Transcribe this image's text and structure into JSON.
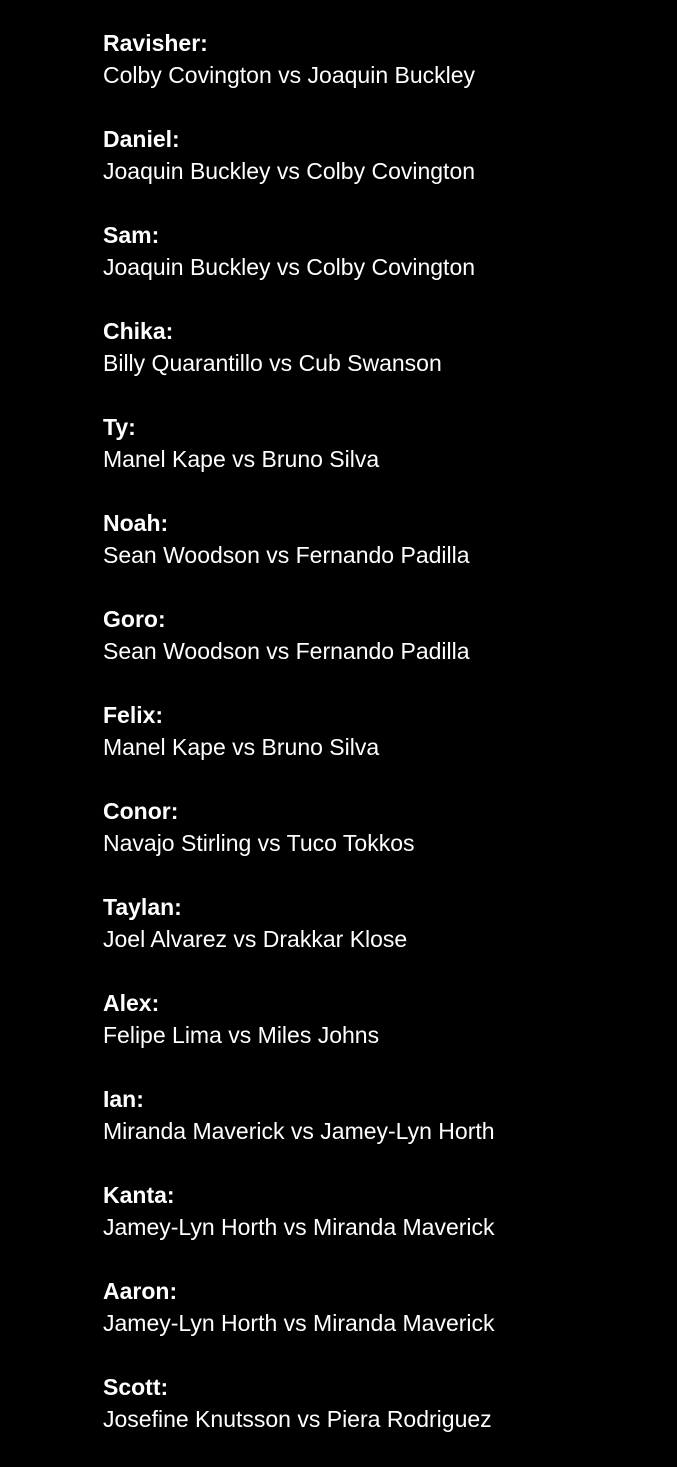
{
  "picks": [
    {
      "name": "Ravisher:",
      "fight": "Colby Covington vs Joaquin Buckley"
    },
    {
      "name": "Daniel:",
      "fight": "Joaquin Buckley vs Colby Covington"
    },
    {
      "name": "Sam:",
      "fight": "Joaquin Buckley vs Colby Covington"
    },
    {
      "name": "Chika:",
      "fight": "Billy Quarantillo vs Cub Swanson"
    },
    {
      "name": "Ty:",
      "fight": "Manel Kape vs Bruno Silva"
    },
    {
      "name": "Noah:",
      "fight": "Sean Woodson vs Fernando Padilla"
    },
    {
      "name": "Goro:",
      "fight": "Sean Woodson vs Fernando Padilla"
    },
    {
      "name": "Felix:",
      "fight": "Manel Kape vs Bruno Silva"
    },
    {
      "name": "Conor:",
      "fight": "Navajo Stirling vs Tuco Tokkos"
    },
    {
      "name": "Taylan:",
      "fight": "Joel Alvarez vs Drakkar Klose"
    },
    {
      "name": "Alex:",
      "fight": "Felipe Lima vs Miles Johns"
    },
    {
      "name": "Ian:",
      "fight": "Miranda Maverick vs Jamey-Lyn Horth"
    },
    {
      "name": "Kanta:",
      "fight": "Jamey-Lyn Horth vs Miranda Maverick"
    },
    {
      "name": "Aaron:",
      "fight": "Jamey-Lyn Horth vs Miranda Maverick"
    },
    {
      "name": "Scott:",
      "fight": "Josefine Knutsson vs Piera Rodriguez"
    }
  ]
}
